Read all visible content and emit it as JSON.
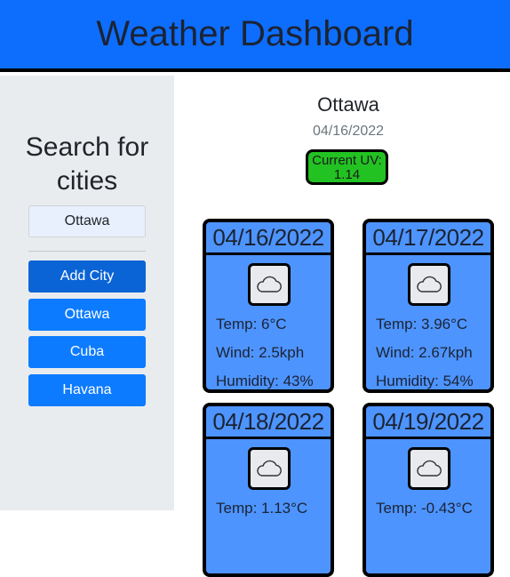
{
  "header": {
    "title": "Weather Dashboard"
  },
  "sidebar": {
    "search_title": "Search for cities",
    "search_value": "Ottawa",
    "buttons": [
      {
        "label": "Add City"
      },
      {
        "label": "Ottawa"
      },
      {
        "label": "Cuba"
      },
      {
        "label": "Havana"
      }
    ]
  },
  "current": {
    "city": "Ottawa",
    "date": "04/16/2022",
    "uv_label": "Current UV:",
    "uv_value": "1.14"
  },
  "forecast": [
    {
      "date": "04/16/2022",
      "icon": "cloud-icon",
      "temp": "Temp: 6°C",
      "wind": "Wind: 2.5kph",
      "humidity": "Humidity: 43%"
    },
    {
      "date": "04/17/2022",
      "icon": "cloud-icon",
      "temp": "Temp: 3.96°C",
      "wind": "Wind: 2.67kph",
      "humidity": "Humidity: 54%"
    },
    {
      "date": "04/18/2022",
      "icon": "cloud-icon",
      "temp": "Temp: 1.13°C"
    },
    {
      "date": "04/19/2022",
      "icon": "cloud-icon",
      "temp": "Temp: -0.43°C"
    }
  ],
  "colors": {
    "header_bg": "#0d6efd",
    "card_bg": "#4d94ff",
    "uv_bg": "#22c222",
    "button_bg": "#0d7bff"
  }
}
